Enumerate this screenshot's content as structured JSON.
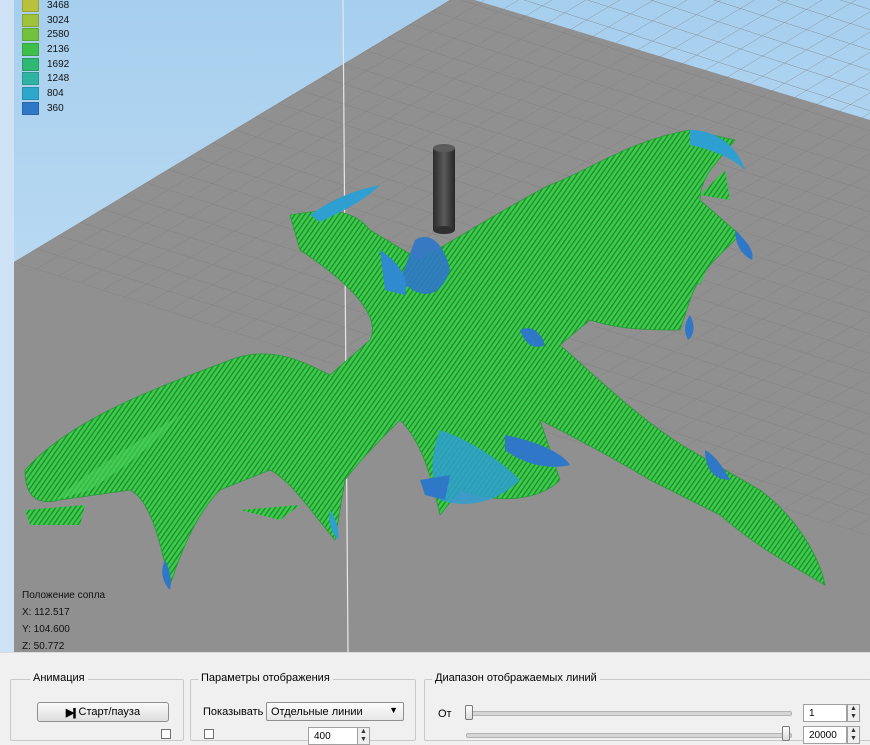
{
  "legend": {
    "items": [
      {
        "label": "3468",
        "color": "#b9c13c"
      },
      {
        "label": "3024",
        "color": "#9fc23d"
      },
      {
        "label": "2580",
        "color": "#72c23f"
      },
      {
        "label": "2136",
        "color": "#3fbf4a"
      },
      {
        "label": "1692",
        "color": "#2fb873"
      },
      {
        "label": "1248",
        "color": "#2fb3a3"
      },
      {
        "label": "804",
        "color": "#2ea7cc"
      },
      {
        "label": "360",
        "color": "#2f78c8"
      }
    ]
  },
  "nozzle": {
    "title": "Положение сопла",
    "x": "X: 112.517",
    "y": "Y: 104.600",
    "z": "Z: 50.772"
  },
  "panel": {
    "animation": {
      "title": "Анимация",
      "start_pause_label": "Старт/пауза",
      "play_icon": "▶||"
    },
    "display": {
      "title": "Параметры отображения",
      "show_label": "Показывать",
      "show_value": "Отдельные линии",
      "spin_value": "400"
    },
    "range": {
      "title": "Диапазон отображаемых линий",
      "from_label": "От",
      "from_value": "1",
      "to_value": "20000"
    }
  },
  "colors": {
    "sky_top": "#a8d0ef",
    "sky_bottom": "#cde3f5",
    "floor": "#8f8f8f",
    "model_green": "#38c447",
    "model_blue": "#2f78c8",
    "nozzle": "#3a3a3a"
  }
}
